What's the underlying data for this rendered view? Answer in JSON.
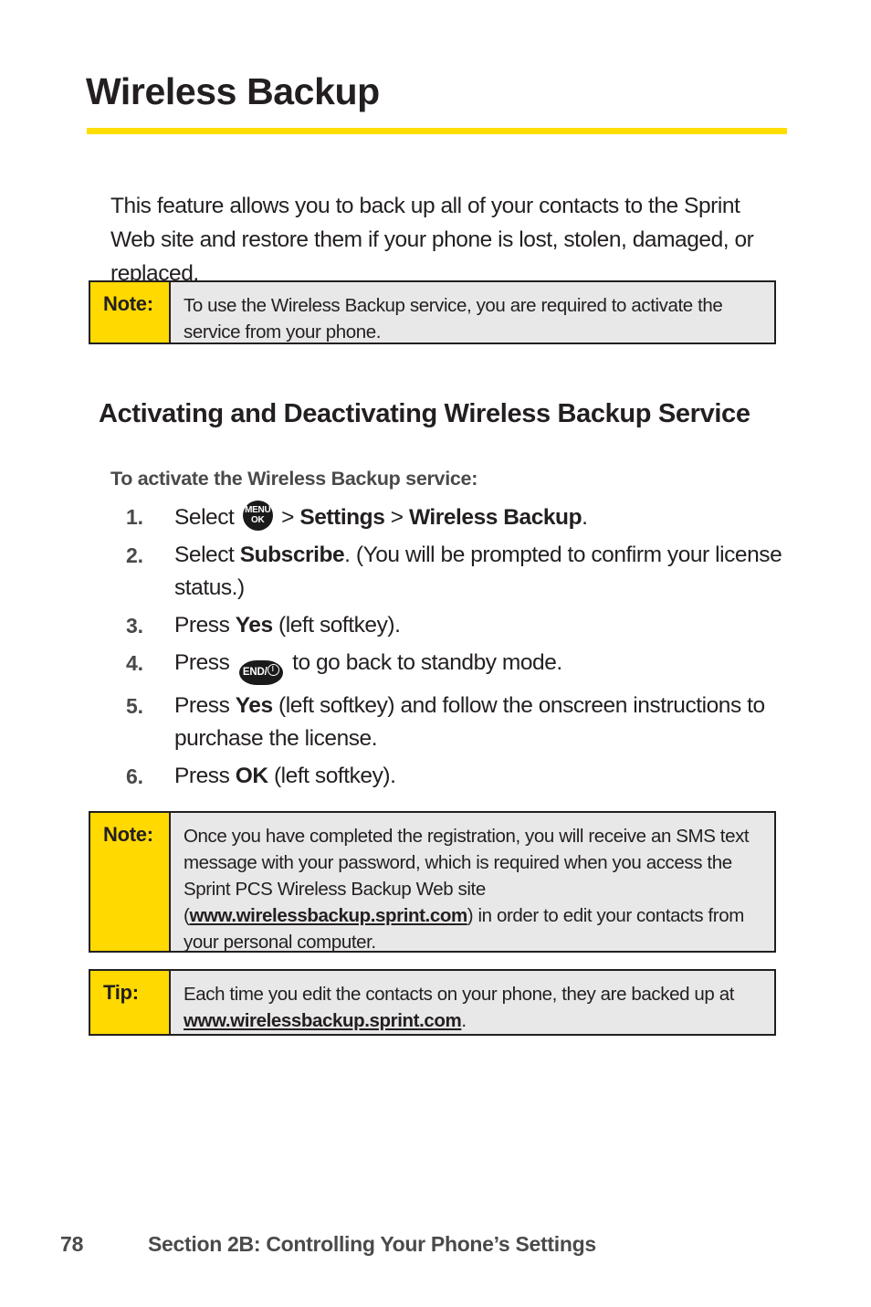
{
  "title": "Wireless Backup",
  "accent_colors": {
    "rule_yellow": "#FFDD00",
    "label_yellow": "#FFD900",
    "callout_background": "#E8E8E8",
    "callout_border": "#231F20",
    "body_text": "#231F20",
    "muted_text": "#4A4A4A"
  },
  "intro": "This feature allows you to back up all of your contacts to the Sprint Web site and restore them if your phone is lost, stolen, damaged, or replaced.",
  "note_1": {
    "label": "Note:",
    "text": "To use the Wireless Backup service, you are required to activate the service from your phone."
  },
  "section_heading": "Activating and Deactivating Wireless Backup Service",
  "sub_heading": "To activate the Wireless Backup service:",
  "steps": [
    {
      "number": "1.",
      "before_icon": "Select ",
      "icon": "menu-ok-key-icon",
      "icon_line1": "MENU",
      "icon_line2": "OK",
      "after_icon_plain": " > ",
      "after_icon_bold": "Settings",
      "tail_plain": " > ",
      "tail_bold": "Wireless Backup",
      "end_punct": "."
    },
    {
      "number": "2.",
      "lead": "Select ",
      "bold": "Subscribe",
      "rest": ". (You will be prompted to confirm your license status.)"
    },
    {
      "number": "3.",
      "lead": "Press ",
      "bold": "Yes",
      "rest": " (left softkey)."
    },
    {
      "number": "4.",
      "before_icon": "Press ",
      "icon": "end-power-key-icon",
      "icon_text": "END/",
      "after_icon": " to go back to standby mode."
    },
    {
      "number": "5.",
      "lead": "Press ",
      "bold": "Yes",
      "rest": " (left softkey) and follow the onscreen instructions to purchase the license."
    },
    {
      "number": "6.",
      "lead": "Press ",
      "bold": "OK",
      "rest": " (left softkey)."
    }
  ],
  "note_2": {
    "label": "Note:",
    "text_before_url": "Once you have completed the registration, you will receive an SMS text message with your password, which is  required when you access the Sprint PCS Wireless Backup Web site (",
    "url": "www.wirelessbackup.sprint.com",
    "text_after_url": ") in order to edit your contacts from your personal computer."
  },
  "tip_1": {
    "label": "Tip:",
    "text_before_url": "Each time you edit the contacts on your phone, they are backed up at ",
    "url": "www.wirelessbackup.sprint.com",
    "text_after_url": "."
  },
  "footer": {
    "page_number": "78",
    "section": "Section 2B: Controlling Your Phone’s Settings"
  }
}
